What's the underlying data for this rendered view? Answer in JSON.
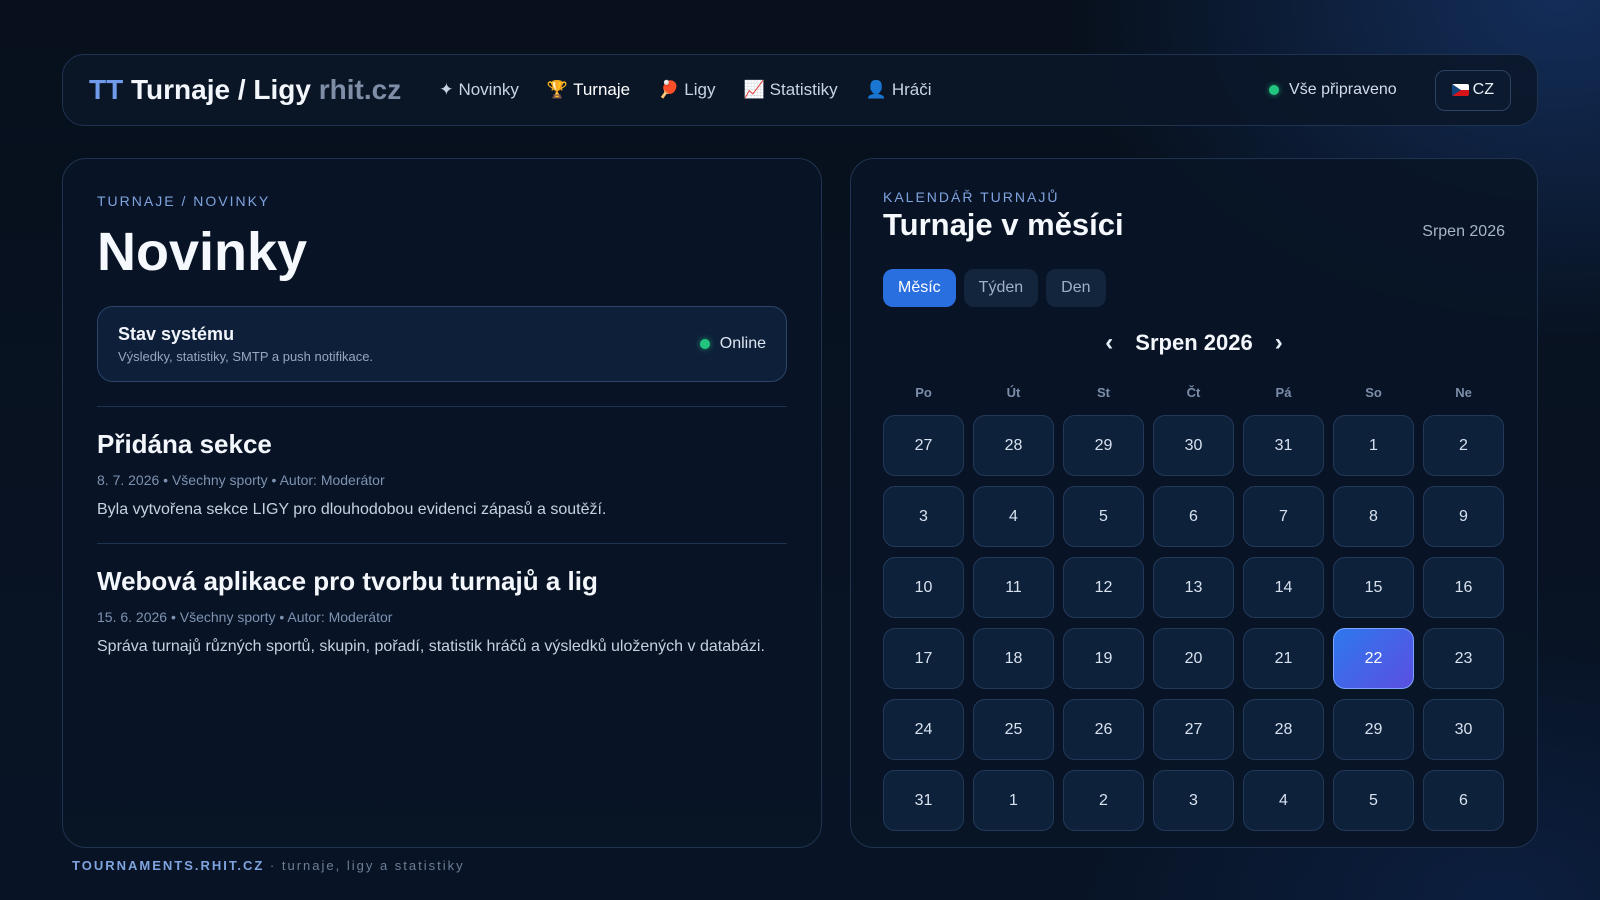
{
  "header": {
    "brand_tt": "TT",
    "brand_title": "Turnaje / Ligy",
    "brand_domain": "rhit.cz",
    "nav": [
      {
        "icon": "✦",
        "label": "Novinky",
        "active": false
      },
      {
        "icon": "🏆",
        "label": "Turnaje",
        "active": true
      },
      {
        "icon": "🏓",
        "label": "Ligy",
        "active": false
      },
      {
        "icon": "📈",
        "label": "Statistiky",
        "active": false
      },
      {
        "icon": "👤",
        "label": "Hráči",
        "active": false
      }
    ],
    "status_text": "Vše připraveno",
    "lang_label": "CZ"
  },
  "left": {
    "breadcrumb": "TURNAJE / NOVINKY",
    "title": "Novinky",
    "status_card": {
      "title": "Stav systému",
      "subtitle": "Výsledky, statistiky, SMTP a push notifikace.",
      "status": "Online"
    },
    "news": [
      {
        "title": "Přidána sekce",
        "meta": "8. 7. 2026 • Všechny sporty • Autor: Moderátor",
        "body": "Byla vytvořena sekce LIGY pro dlouhodobou evidenci zápasů a soutěží."
      },
      {
        "title": "Webová aplikace pro tvorbu turnajů a lig",
        "meta": "15. 6. 2026 • Všechny sporty • Autor: Moderátor",
        "body": "Správa turnajů různých sportů, skupin, pořadí, statistik hráčů a výsledků uložených v databázi."
      }
    ]
  },
  "calendar": {
    "eyebrow": "KALENDÁŘ TURNAJŮ",
    "title": "Turnaje v měsíci",
    "month_right": "Srpen 2026",
    "tabs": [
      {
        "label": "Měsíc",
        "active": true
      },
      {
        "label": "Týden",
        "active": false
      },
      {
        "label": "Den",
        "active": false
      }
    ],
    "prev_symbol": "‹",
    "next_symbol": "›",
    "month_label": "Srpen 2026",
    "weekdays": [
      "Po",
      "Út",
      "St",
      "Čt",
      "Pá",
      "So",
      "Ne"
    ],
    "days": [
      "27",
      "28",
      "29",
      "30",
      "31",
      "1",
      "2",
      "3",
      "4",
      "5",
      "6",
      "7",
      "8",
      "9",
      "10",
      "11",
      "12",
      "13",
      "14",
      "15",
      "16",
      "17",
      "18",
      "19",
      "20",
      "21",
      "22",
      "23",
      "24",
      "25",
      "26",
      "27",
      "28",
      "29",
      "30",
      "31",
      "1",
      "2",
      "3",
      "4",
      "5",
      "6"
    ],
    "selected_index": 26
  },
  "footer": {
    "strong": "TOURNAMENTS.RHIT.CZ",
    "soft": " · turnaje, ligy a statistiky"
  }
}
